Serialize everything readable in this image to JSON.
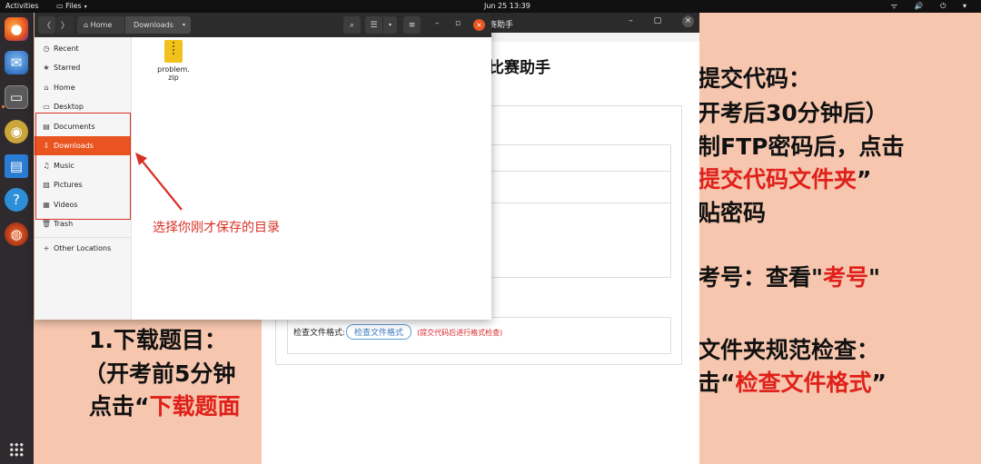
{
  "topbar": {
    "activities": "Activities",
    "app_name": "Files",
    "app_dropdown": "▾",
    "clock": "Jun 25  13:39",
    "tray_icons": "ᯤ 🔊 ⏻ ▾"
  },
  "dock": {
    "apps": [
      "firefox-icon",
      "thunderbird-icon",
      "files-icon",
      "rhythmbox-icon",
      "writer-icon",
      "help-icon",
      "software-icon"
    ]
  },
  "slide": {
    "right_lines": [
      "提交代码：",
      "开考后30分钟后）",
      "制FTP密码后，点击",
      "提交代码文件夹",
      "”",
      "贴密码",
      "考号：查看\"",
      "考号",
      "\"",
      "文件夹规范检查：",
      "击“",
      "检查文件格式",
      "”"
    ],
    "left_lines": [
      "1.下载题目：",
      "（开考前5分钟",
      "点击“",
      "下载题面"
    ]
  },
  "helper": {
    "window_title": "赛助手",
    "window_controls": "–  ▢",
    "close": "×",
    "heading": "比赛助手",
    "check_label": "检查文件格式:",
    "check_button": "检查文件格式",
    "check_hint": "(提交代码后进行格式检查)"
  },
  "filemanager": {
    "back": "〈",
    "forward": "〉",
    "home_crumb": "Home",
    "current_crumb": "Downloads",
    "crumb_caret": "▾",
    "search_icon": "⌕",
    "view_icon": "☰",
    "view_caret": "▾",
    "menu_icon": "≡",
    "minimize": "–",
    "maximize": "▫",
    "close": "×",
    "sidebar": [
      {
        "label": "Recent",
        "icon": "◷"
      },
      {
        "label": "Starred",
        "icon": "★"
      },
      {
        "label": "Home",
        "icon": "⌂"
      },
      {
        "label": "Desktop",
        "icon": "▭"
      },
      {
        "label": "Documents",
        "icon": "▤"
      },
      {
        "label": "Downloads",
        "icon": "⇩"
      },
      {
        "label": "Music",
        "icon": "♫"
      },
      {
        "label": "Pictures",
        "icon": "▨"
      },
      {
        "label": "Videos",
        "icon": "▦"
      },
      {
        "label": "Trash",
        "icon": "🗑"
      },
      {
        "label": "Other Locations",
        "icon": "+"
      }
    ],
    "file_name_line1": "problem.",
    "file_name_line2": "zip"
  },
  "annotation": "选择你刚才保存的目录",
  "colors": {
    "accent": "#e95420",
    "annotation_red": "#d93025",
    "slide_bg": "#f6c6ae"
  }
}
